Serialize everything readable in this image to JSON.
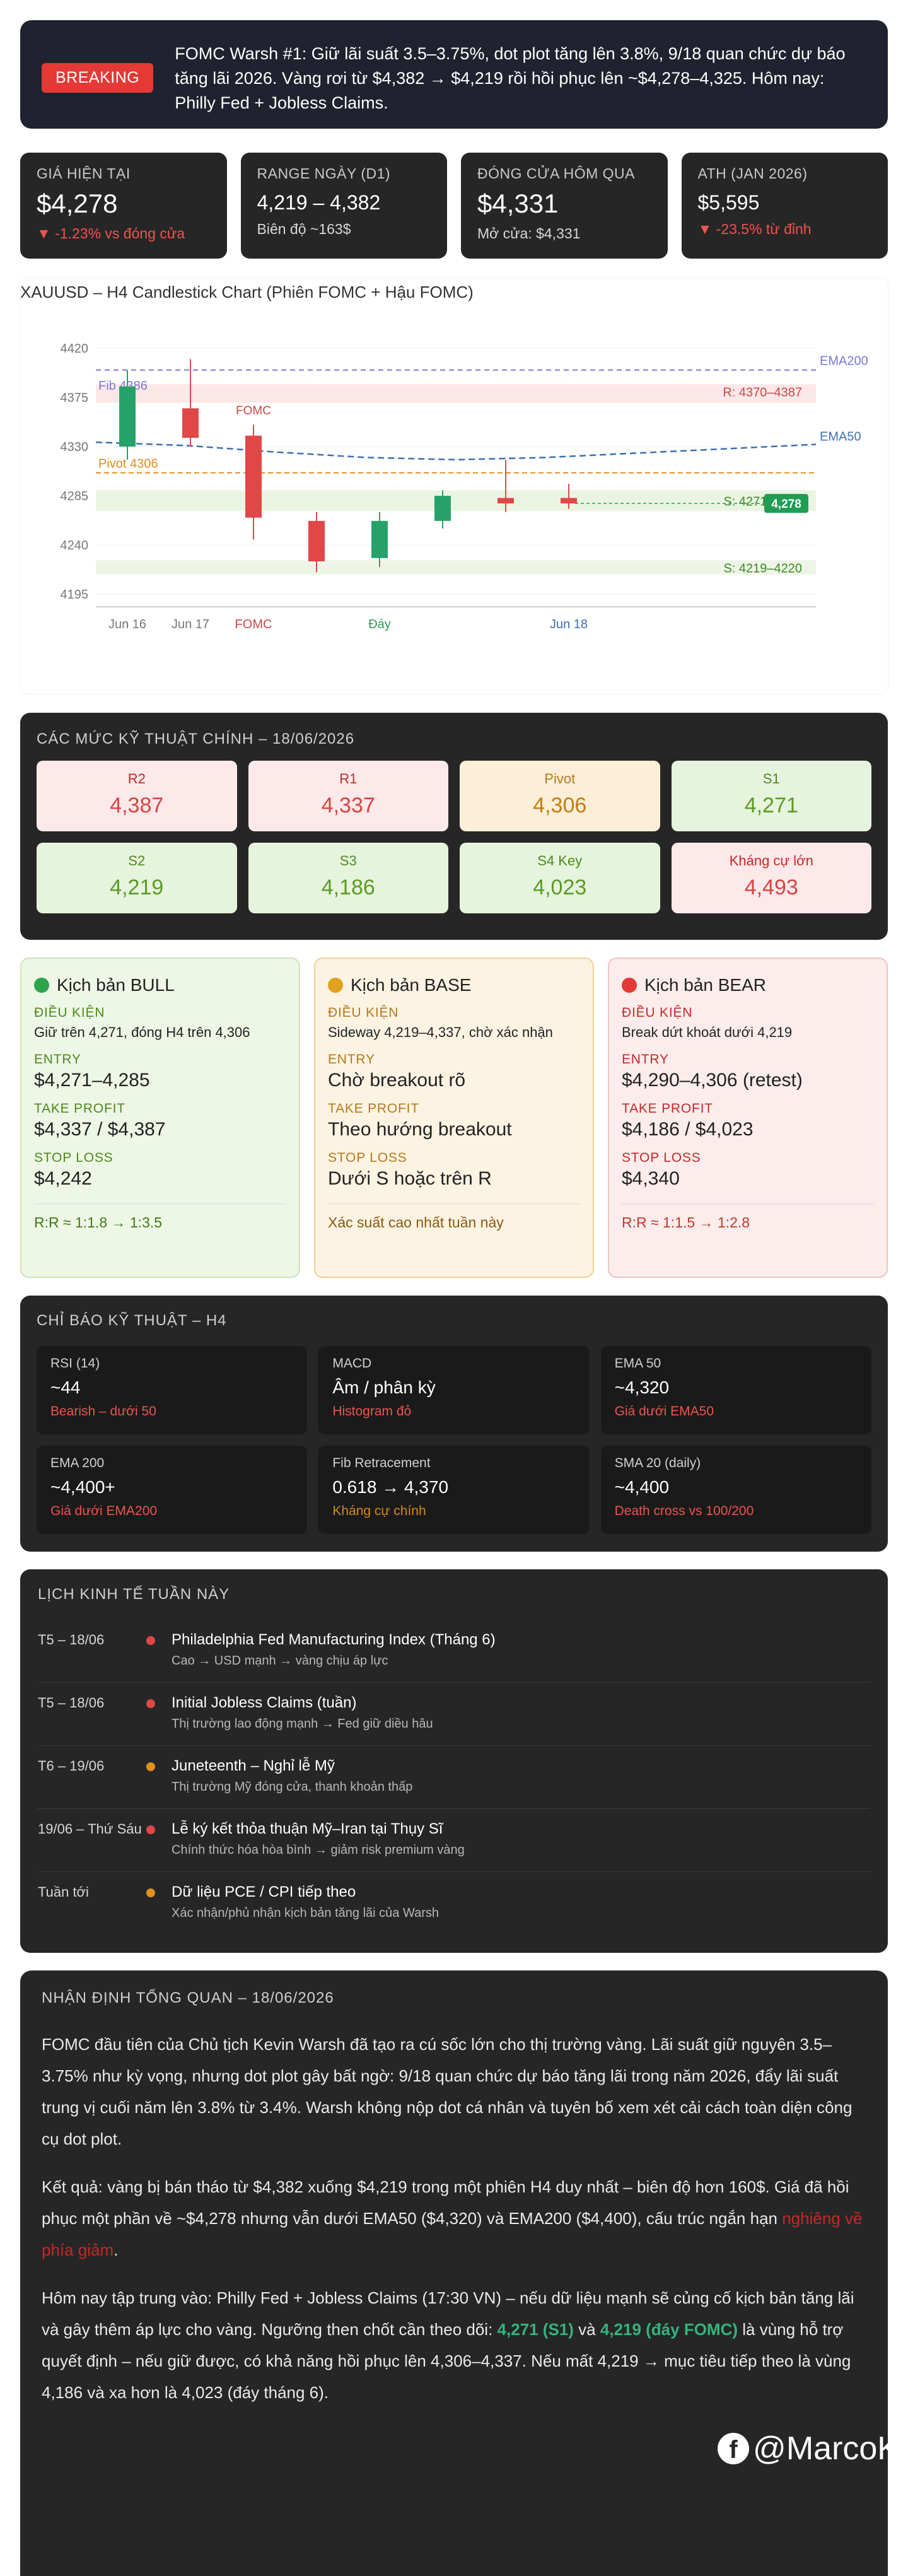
{
  "breaking": {
    "badge": "BREAKING",
    "text": "FOMC Warsh #1: Giữ lãi suất 3.5–3.75%, dot plot tăng lên 3.8%, 9/18 quan chức dự báo tăng lãi 2026. Vàng rơi từ $4,382 → $4,219 rồi hồi phục lên ~$4,278–4,325. Hôm nay: Philly Fed + Jobless Claims."
  },
  "stats": [
    {
      "label": "GIÁ HIỆN TẠI",
      "value": "$4,278",
      "sub": "▼ -1.23% vs đóng cửa"
    },
    {
      "label": "RANGE NGÀY (D1)",
      "value": "4,219 – 4,382",
      "sub": "Biên độ ~163$"
    },
    {
      "label": "ĐÓNG CỬA HÔM QUA",
      "value": "$4,331",
      "sub": "Mở cửa: $4,331"
    },
    {
      "label": "ATH (JAN 2026)",
      "value": "$5,595",
      "sub": "▼ -23.5% từ đỉnh"
    }
  ],
  "chart": {
    "title": "XAUUSD – H4 Candlestick Chart (Phiên FOMC + Hậu FOMC)",
    "labels": {
      "ema200": "EMA200",
      "ema50": "EMA50",
      "fib": "Fib 4386",
      "pivot": "Pivot 4306",
      "resist": "R: 4370–4387",
      "s1": "S: 4271–4290",
      "s2": "S: 4219–4220",
      "fomc": "FOMC",
      "price_tag": "4,278"
    },
    "colors": {
      "up": "#26a269",
      "down": "#e04848",
      "ema200": "#7b78d6",
      "ema50": "#3d6fb0",
      "pivot": "#e08a1e"
    }
  },
  "chart_data": {
    "type": "candlestick",
    "title": "XAUUSD – H4 Candlestick Chart (Phiên FOMC + Hậu FOMC)",
    "y_ticks": [
      4420,
      4375,
      4330,
      4285,
      4240,
      4195
    ],
    "ylim": [
      4190,
      4430
    ],
    "x_ticks": [
      "Jun 16",
      "Jun 17",
      "FOMC",
      "Đáy",
      "Jun 18"
    ],
    "candles": [
      {
        "open": 4330,
        "close": 4385,
        "high": 4400,
        "low": 4318
      },
      {
        "open": 4365,
        "close": 4338,
        "high": 4410,
        "low": 4330
      },
      {
        "open": 4340,
        "close": 4265,
        "high": 4350,
        "low": 4245
      },
      {
        "open": 4262,
        "close": 4225,
        "high": 4270,
        "low": 4215
      },
      {
        "open": 4228,
        "close": 4262,
        "high": 4270,
        "low": 4220
      },
      {
        "open": 4262,
        "close": 4285,
        "high": 4290,
        "low": 4255
      },
      {
        "open": 4283,
        "close": 4278,
        "high": 4318,
        "low": 4270
      },
      {
        "open": 4283,
        "close": 4278,
        "high": 4296,
        "low": 4273
      }
    ],
    "lines": {
      "ema200": 4400,
      "ema50": [
        4334,
        4331,
        4325,
        4320,
        4318,
        4320,
        4324,
        4328,
        4332
      ],
      "pivot": 4306,
      "fib": 4386,
      "current": 4278
    },
    "zones": [
      {
        "label": "R: 4370–4387",
        "from": 4370,
        "to": 4387
      },
      {
        "label": "S: 4271–4290",
        "from": 4271,
        "to": 4290
      },
      {
        "label": "S: 4219–4220",
        "from": 4213,
        "to": 4226
      }
    ]
  },
  "levels": {
    "title": "CÁC MỨC KỸ THUẬT CHÍNH – 18/06/2026",
    "items": [
      {
        "name": "R2",
        "value": "4,387"
      },
      {
        "name": "R1",
        "value": "4,337"
      },
      {
        "name": "Pivot",
        "value": "4,306"
      },
      {
        "name": "S1",
        "value": "4,271"
      },
      {
        "name": "S2",
        "value": "4,219"
      },
      {
        "name": "S3",
        "value": "4,186"
      },
      {
        "name": "S4 Key",
        "value": "4,023"
      },
      {
        "name": "Kháng cự lớn",
        "value": "4,493"
      }
    ]
  },
  "scenarios": {
    "bull": {
      "title": "Kịch bản BULL",
      "cond_label": "ĐIỀU KIỆN",
      "cond": "Giữ trên 4,271, đóng H4 trên 4,306",
      "entry_label": "ENTRY",
      "entry": "$4,271–4,285",
      "tp_label": "TAKE PROFIT",
      "tp": "$4,337 / $4,387",
      "sl_label": "STOP LOSS",
      "sl": "$4,242",
      "rr": "R:R ≈ 1:1.8 → 1:3.5"
    },
    "base": {
      "title": "Kịch bản BASE",
      "cond_label": "ĐIỀU KIỆN",
      "cond": "Sideway 4,219–4,337, chờ xác nhận",
      "entry_label": "ENTRY",
      "entry": "Chờ breakout rõ",
      "tp_label": "TAKE PROFIT",
      "tp": "Theo hướng breakout",
      "sl_label": "STOP LOSS",
      "sl": "Dưới S hoặc trên R",
      "rr": "Xác suất cao nhất tuần này"
    },
    "bear": {
      "title": "Kịch bản BEAR",
      "cond_label": "ĐIỀU KIỆN",
      "cond": "Break dứt khoát dưới 4,219",
      "entry_label": "ENTRY",
      "entry": "$4,290–4,306 (retest)",
      "tp_label": "TAKE PROFIT",
      "tp": "$4,186 / $4,023",
      "sl_label": "STOP LOSS",
      "sl": "$4,340",
      "rr": "R:R ≈ 1:1.5 → 1:2.8"
    }
  },
  "indicators": {
    "title": "CHỈ BÁO KỸ THUẬT – H4",
    "items": [
      {
        "name": "RSI (14)",
        "value": "~44",
        "sub": "Bearish – dưới 50"
      },
      {
        "name": "MACD",
        "value": "Âm / phân kỳ",
        "sub": "Histogram đỏ"
      },
      {
        "name": "EMA 50",
        "value": "~4,320",
        "sub": "Giá dưới EMA50"
      },
      {
        "name": "EMA 200",
        "value": "~4,400+",
        "sub": "Giá dưới EMA200"
      },
      {
        "name": "Fib Retracement",
        "value": "0.618 → 4,370",
        "sub": "Kháng cự chính"
      },
      {
        "name": "SMA 20 (daily)",
        "value": "~4,400",
        "sub": "Death cross vs 100/200"
      }
    ]
  },
  "calendar": {
    "title": "LỊCH KINH TẾ TUẦN NÀY",
    "events": [
      {
        "date": "T5 – 18/06",
        "title": "Philadelphia Fed Manufacturing Index (Tháng 6)",
        "desc": "Cao → USD mạnh → vàng chịu áp lực",
        "color": "#e04848"
      },
      {
        "date": "T5 – 18/06",
        "title": "Initial Jobless Claims (tuần)",
        "desc": "Thị trường lao động mạnh → Fed giữ diều hâu",
        "color": "#e04848"
      },
      {
        "date": "T6 – 19/06",
        "title": "Juneteenth – Nghỉ lễ Mỹ",
        "desc": "Thị trường Mỹ đóng cửa, thanh khoản thấp",
        "color": "#e0901e"
      },
      {
        "date": "19/06 – Thứ Sáu",
        "title": "Lễ ký kết thỏa thuận Mỹ–Iran tại Thụy Sĩ",
        "desc": "Chính thức hóa hòa bình → giảm risk premium vàng",
        "color": "#e04848"
      },
      {
        "date": "Tuần tới",
        "title": "Dữ liệu PCE / CPI tiếp theo",
        "desc": "Xác nhận/phủ nhận kịch bản tăng lãi của Warsh",
        "color": "#e0901e"
      }
    ]
  },
  "summary": {
    "title": "NHẬN ĐỊNH TỔNG QUAN – 18/06/2026",
    "p1": "FOMC đầu tiên của Chủ tịch Kevin Warsh đã tạo ra cú sốc lớn cho thị trường vàng. Lãi suất giữ nguyên 3.5–3.75% như kỳ vọng, nhưng dot plot gây bất ngờ: 9/18 quan chức dự báo tăng lãi trong năm 2026, đẩy lãi suất trung vị cuối năm lên 3.8% từ 3.4%. Warsh không nộp dot cá nhân và tuyên bố xem xét cải cách toàn diện công cụ dot plot.",
    "p2_a": "Kết quả: vàng bị bán tháo từ $4,382 xuống $4,219 trong một phiên H4 duy nhất – biên độ hơn 160$. Giá đã hồi phục một phần về ~$4,278 nhưng vẫn dưới EMA50 ($4,320) và EMA200 ($4,400), cấu trúc ngắn hạn ",
    "p2_hl": "nghiêng về phía giảm",
    "p2_b": ".",
    "p3_a": "Hôm nay tập trung vào: Philly Fed + Jobless Claims (17:30 VN) – nếu dữ liệu mạnh sẽ củng cố kịch bản tăng lãi và gây thêm áp lực cho vàng. Ngưỡng then chốt cần theo dõi: ",
    "p3_hl1": "4,271 (S1)",
    "p3_mid": " và ",
    "p3_hl2": "4,219 (đáy FOMC)",
    "p3_b": " là vùng hỗ trợ quyết định – nếu giữ được, có khả năng hồi phục lên 4,306–4,337. Nếu mất 4,219 → mục tiêu tiếp theo là vùng 4,186 và xa hơn là 4,023 (đáy tháng 6).",
    "watermark": "@MarcoK"
  },
  "colors": {
    "bull_dot": "#2ea44f",
    "base_dot": "#e0a21e",
    "bear_dot": "#e53935"
  }
}
